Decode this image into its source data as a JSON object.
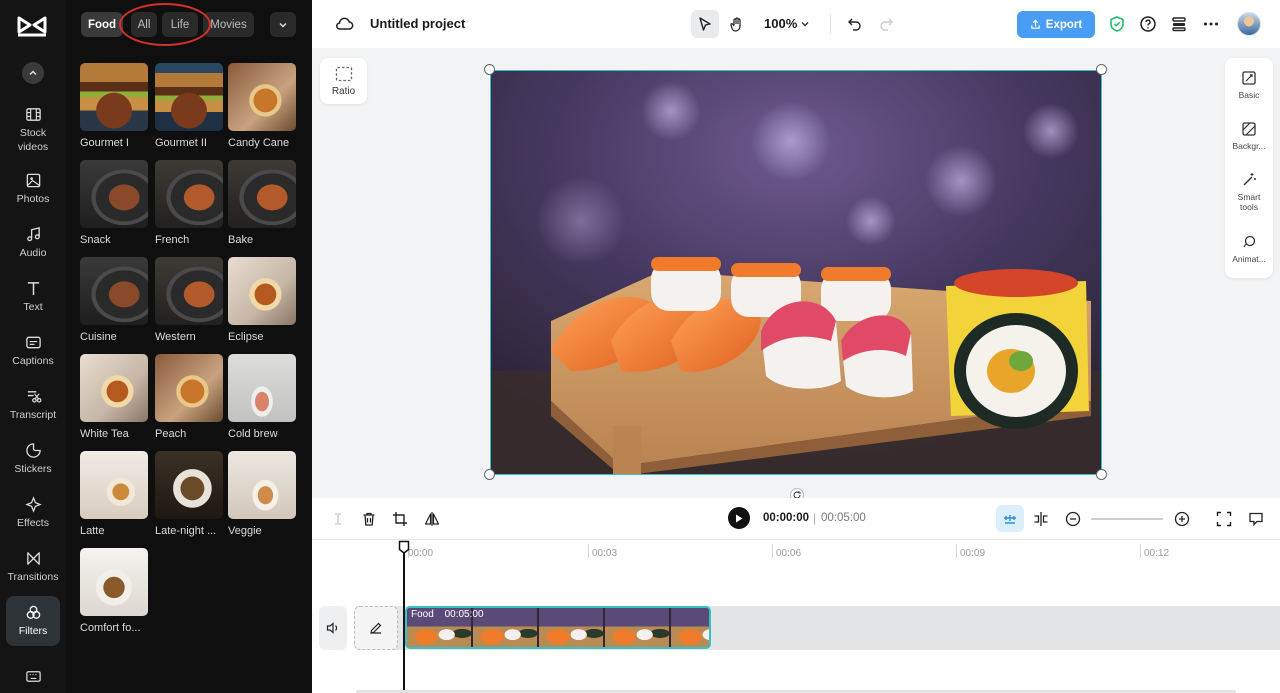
{
  "nav": {
    "items": [
      {
        "label": "Stock\nvideos",
        "icon": "film-icon"
      },
      {
        "label": "Photos",
        "icon": "image-icon"
      },
      {
        "label": "Audio",
        "icon": "music-icon"
      },
      {
        "label": "Text",
        "icon": "text-icon"
      },
      {
        "label": "Captions",
        "icon": "captions-icon"
      },
      {
        "label": "Transcript",
        "icon": "transcript-icon"
      },
      {
        "label": "Stickers",
        "icon": "sticker-icon"
      },
      {
        "label": "Effects",
        "icon": "effects-icon"
      },
      {
        "label": "Transitions",
        "icon": "transitions-icon"
      },
      {
        "label": "Filters",
        "icon": "filters-icon",
        "active": true
      }
    ]
  },
  "filter_panel": {
    "tabs": [
      "Food",
      "All",
      "Life",
      "Movies"
    ],
    "active_tab": "Food",
    "tiles": [
      "Gourmet I",
      "Gourmet II",
      "Candy Cane",
      "Snack",
      "French",
      "Bake",
      "Cuisine",
      "Western",
      "Eclipse",
      "White Tea",
      "Peach",
      "Cold brew",
      "Latte",
      "Late-night ...",
      "Veggie",
      "Comfort fo..."
    ]
  },
  "header": {
    "project_title": "Untitled project",
    "zoom": "100%",
    "export_label": "Export"
  },
  "canvas": {
    "ratio_label": "Ratio"
  },
  "right_tools": [
    "Basic",
    "Backgr...",
    "Smart\ntools",
    "Animat..."
  ],
  "playback": {
    "current_time": "00:00:00",
    "separator": "|",
    "total_time": "00:05:00"
  },
  "timeline": {
    "ticks": [
      "00:00",
      "00:03",
      "00:06",
      "00:09",
      "00:12"
    ],
    "clip": {
      "name": "Food",
      "duration": "00:05:00"
    }
  },
  "colors": {
    "accent": "#37c1c6",
    "export": "#4a9df5",
    "annotation": "#d2322a"
  }
}
